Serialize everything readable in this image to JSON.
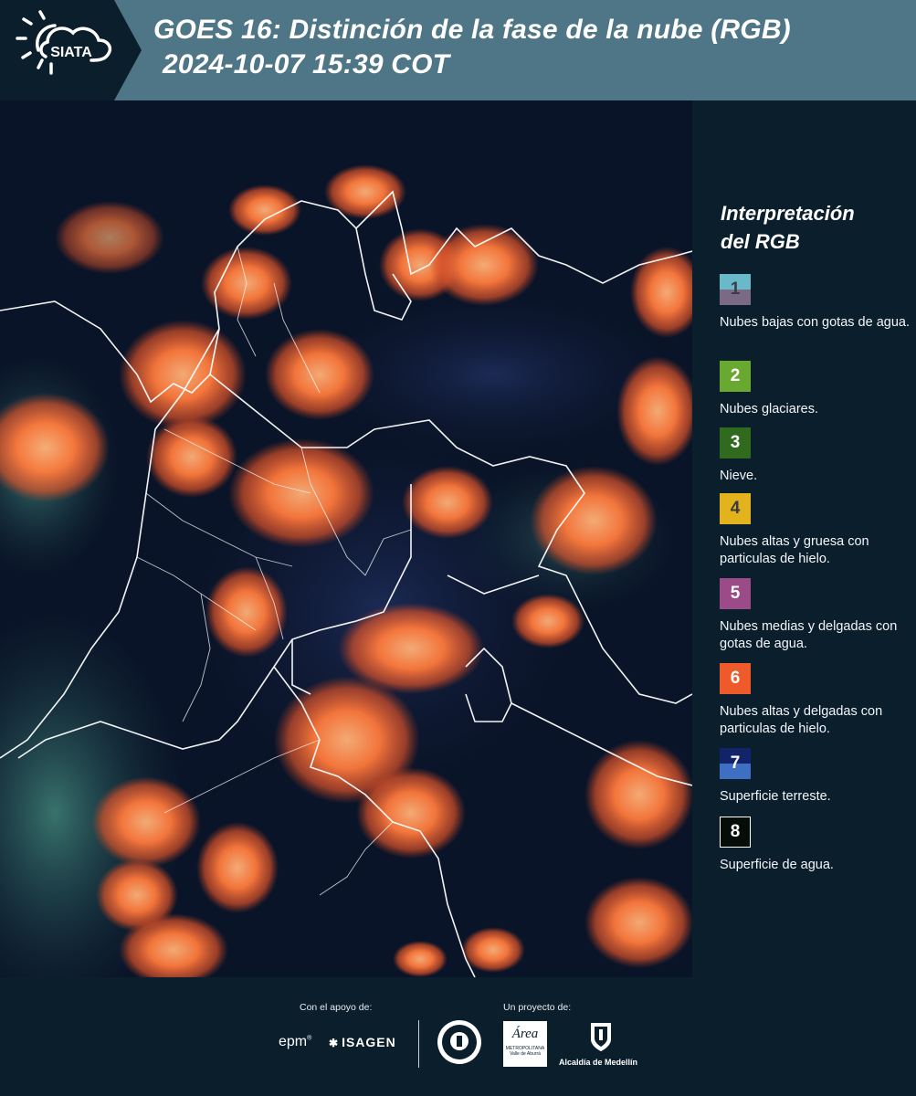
{
  "header": {
    "logo_text": "SIATA",
    "title_line1": "GOES 16: Distinción de la fase de la nube (RGB)",
    "title_line2": "2024-10-07 15:39 COT"
  },
  "legend": {
    "title_line1": "Interpretación",
    "title_line2": "del RGB",
    "items": [
      {
        "number": "1",
        "label": "Nubes bajas con gotas de agua.",
        "color_top": "#6ab9c8",
        "color_bottom": "#7b6a86"
      },
      {
        "number": "2",
        "label": "Nubes glaciares.",
        "color": "#6aa92f"
      },
      {
        "number": "3",
        "label": "Nieve.",
        "color": "#2f6a1e"
      },
      {
        "number": "4",
        "label": "Nubes altas y gruesa con particulas de hielo.",
        "color": "#e2b31c"
      },
      {
        "number": "5",
        "label": "Nubes medias y delgadas con gotas de agua.",
        "color": "#9b4b87"
      },
      {
        "number": "6",
        "label": "Nubes altas y delgadas con particulas de hielo.",
        "color": "#ee5a2a"
      },
      {
        "number": "7",
        "label": "Superficie terreste.",
        "color_top": "#13236a",
        "color_bottom": "#3f6fc2"
      },
      {
        "number": "8",
        "label": "Superficie de agua.",
        "color": "#050d08"
      }
    ]
  },
  "footer": {
    "support_label": "Con el apoyo de:",
    "project_label": "Un proyecto de:",
    "sponsors": [
      "epm",
      "ISAGEN"
    ],
    "area_text": "Área",
    "area_subtext": "METROPOLITANA",
    "area_subtext2": "Valle de Aburrá",
    "medellin_text": "Alcaldía de Medellín"
  },
  "icons": {
    "sun_cloud": "sun-cloud-icon",
    "isagen": "isagen-star-icon",
    "seal": "seal-icon",
    "medellin_shield": "shield-icon"
  }
}
